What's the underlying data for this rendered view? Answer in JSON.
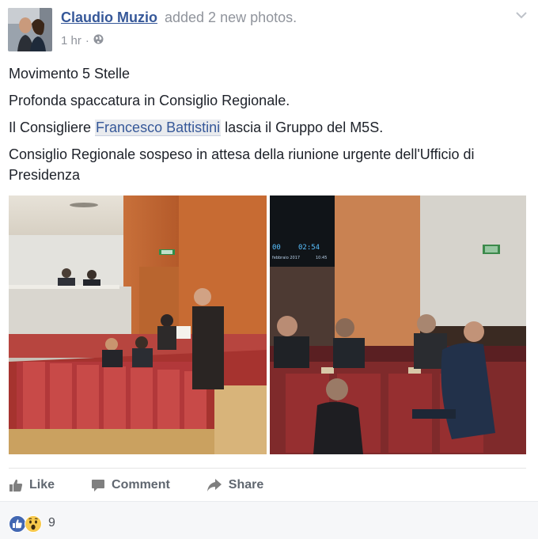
{
  "post": {
    "author": "Claudio Muzio",
    "action_text": "added 2 new photos.",
    "time": "1 hr",
    "separator": "·",
    "privacy_icon": "globe-icon",
    "options_icon": "chevron-down-icon"
  },
  "content": {
    "line1": "Movimento 5 Stelle",
    "line2": "Profonda spaccatura in Consiglio Regionale.",
    "line3_pre": "Il Consigliere ",
    "line3_mention": "Francesco Battistini",
    "line3_post": " lascia il Gruppo del M5S.",
    "line4": "Consiglio Regionale sospeso in attesa della riunione urgente dell'Ufficio di Presidenza"
  },
  "photos": {
    "screen_time": "02:54",
    "screen_left": "00",
    "screen_date": "febbraio 2017",
    "screen_right": "10:45",
    "exit_sign": "EXIT"
  },
  "actions": {
    "like": "Like",
    "comment": "Comment",
    "share": "Share"
  },
  "reactions": {
    "count": "9",
    "types": [
      "like-reaction-icon",
      "wow-reaction-icon"
    ]
  },
  "colors": {
    "link": "#365899",
    "meta": "#90949c",
    "action": "#606770",
    "like_blue": "#4267b2",
    "wow_yellow": "#f7c94c"
  }
}
